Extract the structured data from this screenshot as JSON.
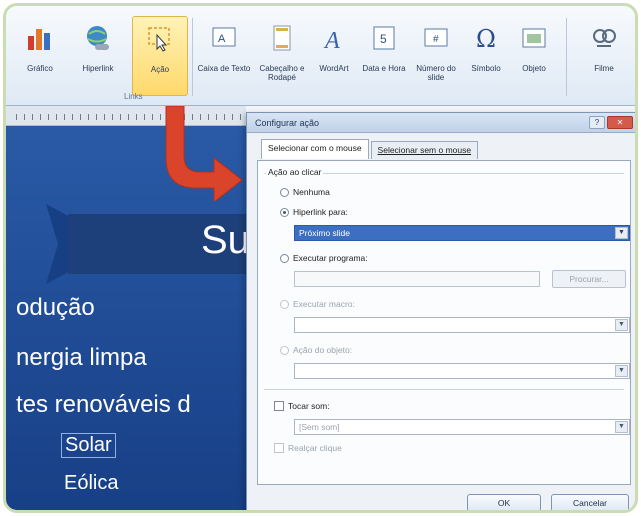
{
  "ribbon": {
    "buttons": [
      {
        "label": "Gráfico",
        "icon": "chart-icon"
      },
      {
        "label": "Hiperlink",
        "icon": "globe-link-icon"
      },
      {
        "label": "Ação",
        "icon": "action-icon",
        "active": true
      },
      {
        "label": "Caixa de Texto",
        "icon": "textbox-icon"
      },
      {
        "label": "Cabeçalho e Rodapé",
        "icon": "header-footer-icon"
      },
      {
        "label": "WordArt",
        "icon": "wordart-icon"
      },
      {
        "label": "Data e Hora",
        "icon": "date-time-icon"
      },
      {
        "label": "Número do slide",
        "icon": "slide-number-icon"
      },
      {
        "label": "Símbolo",
        "icon": "omega-icon"
      },
      {
        "label": "Objeto",
        "icon": "object-icon"
      },
      {
        "label": "Filme",
        "icon": "film-icon"
      }
    ],
    "group_label": "Links"
  },
  "slide": {
    "title": "Su",
    "lines": [
      "odução",
      "nergia limpa",
      "tes renováveis d"
    ],
    "subitems": [
      "Solar",
      "Eólica"
    ]
  },
  "dialog": {
    "title": "Configurar ação",
    "tabs": {
      "active": "Selecionar com o mouse",
      "inactive": "Selecionar sem o mouse"
    },
    "section_label": "Ação ao clicar",
    "options": {
      "none": "Nenhuma",
      "hyperlink": "Hiperlink para:",
      "hyperlink_value": "Próximo slide",
      "run_program": "Executar programa:",
      "browse": "Procurar...",
      "run_macro": "Executar macro:",
      "object_action": "Ação do objeto:",
      "play_sound": "Tocar som:",
      "sound_value": "[Sem som]",
      "highlight": "Realçar clique"
    },
    "ok": "OK",
    "cancel": "Cancelar"
  },
  "colors": {
    "slide_bg": "#1f4c97",
    "arrow": "#d9442b",
    "frame": "#c9dcb2",
    "selection": "#3d6fc1"
  }
}
